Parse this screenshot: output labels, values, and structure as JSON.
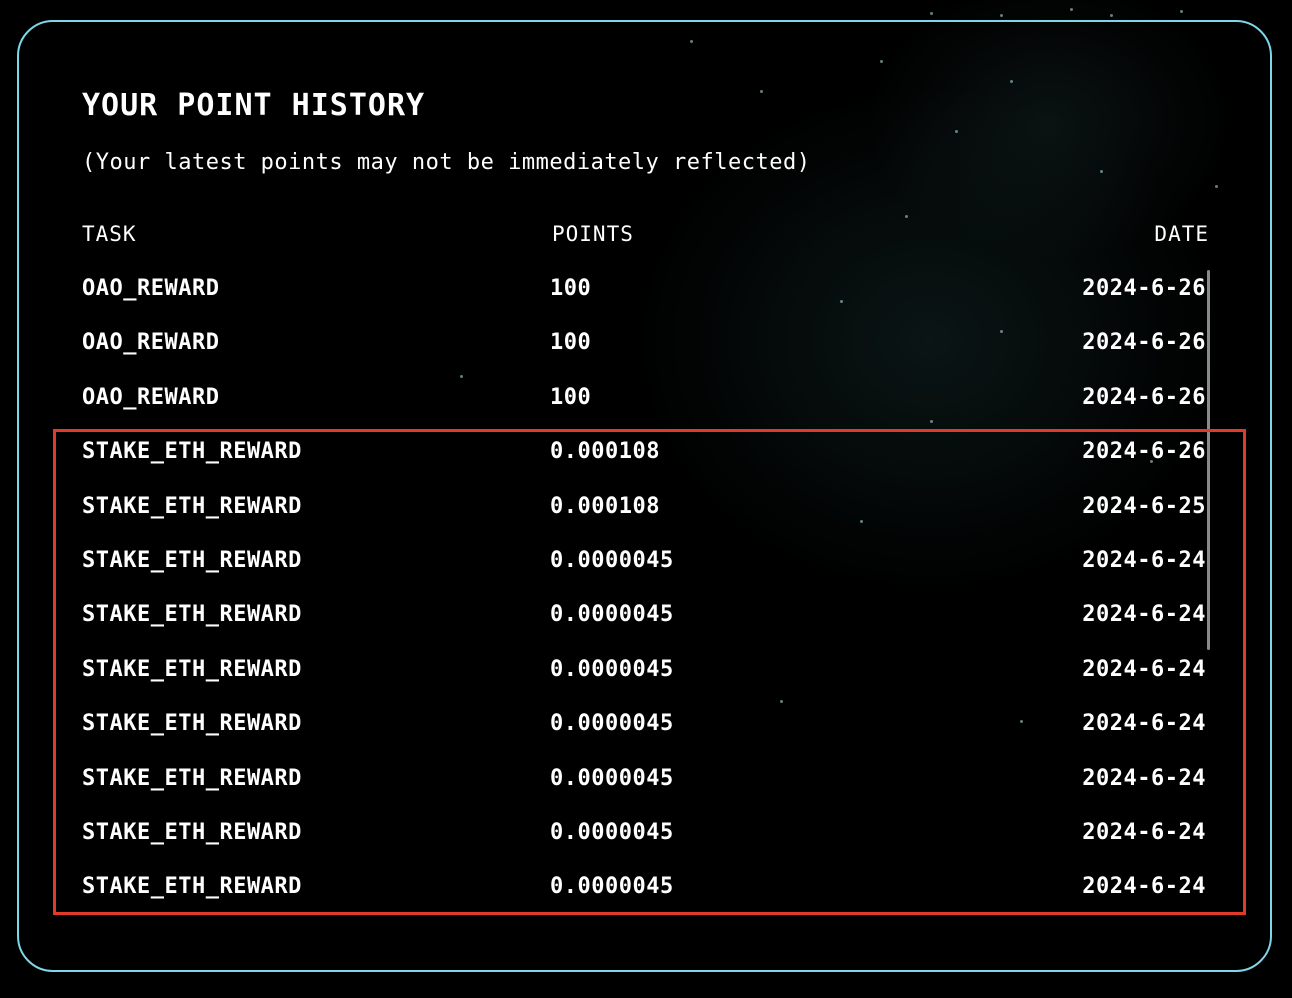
{
  "panel": {
    "title": "YOUR POINT HISTORY",
    "subtitle": "(Your latest points may not be immediately reflected)"
  },
  "table": {
    "headers": {
      "task": "TASK",
      "points": "POINTS",
      "date": "DATE"
    },
    "rows": [
      {
        "task": "OAO_REWARD",
        "points": "100",
        "date": "2024-6-26"
      },
      {
        "task": "OAO_REWARD",
        "points": "100",
        "date": "2024-6-26"
      },
      {
        "task": "OAO_REWARD",
        "points": "100",
        "date": "2024-6-26"
      },
      {
        "task": "STAKE_ETH_REWARD",
        "points": "0.000108",
        "date": "2024-6-26"
      },
      {
        "task": "STAKE_ETH_REWARD",
        "points": "0.000108",
        "date": "2024-6-25"
      },
      {
        "task": "STAKE_ETH_REWARD",
        "points": "0.0000045",
        "date": "2024-6-24"
      },
      {
        "task": "STAKE_ETH_REWARD",
        "points": "0.0000045",
        "date": "2024-6-24"
      },
      {
        "task": "STAKE_ETH_REWARD",
        "points": "0.0000045",
        "date": "2024-6-24"
      },
      {
        "task": "STAKE_ETH_REWARD",
        "points": "0.0000045",
        "date": "2024-6-24"
      },
      {
        "task": "STAKE_ETH_REWARD",
        "points": "0.0000045",
        "date": "2024-6-24"
      },
      {
        "task": "STAKE_ETH_REWARD",
        "points": "0.0000045",
        "date": "2024-6-24"
      },
      {
        "task": "STAKE_ETH_REWARD",
        "points": "0.0000045",
        "date": "2024-6-24"
      }
    ]
  },
  "colors": {
    "panel_border": "#7fd6e6",
    "highlight": "#e03a2a",
    "background": "#000000",
    "text": "#ffffff"
  }
}
